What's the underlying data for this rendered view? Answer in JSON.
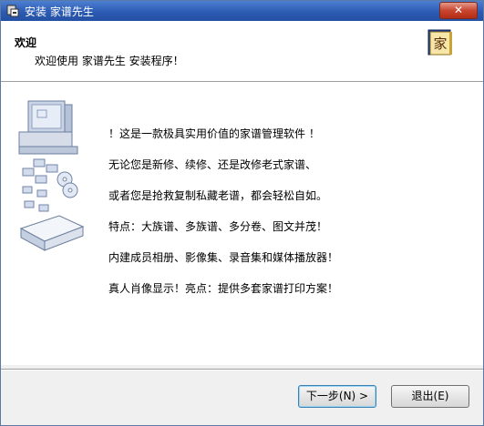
{
  "window": {
    "title": "安装 家谱先生",
    "close_label": "✕"
  },
  "header": {
    "title": "欢迎",
    "subtitle": "欢迎使用 家谱先生 安装程序！",
    "logo_char": "家"
  },
  "body": {
    "lines": [
      "！这是一款极具实用价值的家谱管理软件 ！",
      "无论您是新修、续修、还是改修老式家谱、",
      "或者您是抢救复制私藏老谱，都会轻松自如。",
      "特点：大族谱、多族谱、多分卷、图文并茂！",
      "内建成员相册、影像集、录音集和媒体播放器！",
      "真人肖像显示！亮点：提供多套家谱打印方案！"
    ]
  },
  "buttons": {
    "next": "下一步(N) >",
    "exit": "退出(E)"
  },
  "colors": {
    "titlebar": "#2c5bb3",
    "logo_bg": "#2b4fa8",
    "logo_fg": "#e8c13a"
  }
}
